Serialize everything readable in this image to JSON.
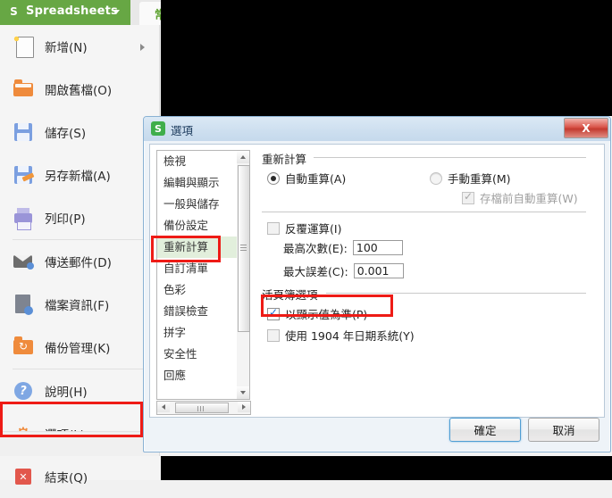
{
  "app": {
    "brand": {
      "logo": "S",
      "name": "Spreadsheets",
      "caret": "dropdown-caret"
    },
    "ribbon_tab": "常用",
    "menu_items": [
      {
        "label": "新增(N)",
        "icon": "new-document-icon",
        "has_submenu": true
      },
      {
        "label": "開啟舊檔(O)",
        "icon": "open-folder-icon",
        "has_submenu": false
      },
      {
        "label": "儲存(S)",
        "icon": "save-disk-icon",
        "has_submenu": false
      },
      {
        "label": "另存新檔(A)",
        "icon": "save-as-icon",
        "has_submenu": false
      },
      {
        "label": "列印(P)",
        "icon": "printer-icon",
        "has_submenu": false
      },
      {
        "label": "傳送郵件(D)",
        "icon": "mail-icon",
        "has_submenu": false
      },
      {
        "label": "檔案資訊(F)",
        "icon": "file-info-icon",
        "has_submenu": false
      },
      {
        "label": "備份管理(K)",
        "icon": "backup-folder-icon",
        "has_submenu": false
      },
      {
        "label": "說明(H)",
        "icon": "help-icon",
        "has_submenu": false
      },
      {
        "label": "選項(L)",
        "icon": "gear-icon",
        "has_submenu": false
      },
      {
        "label": "結束(Q)",
        "icon": "exit-icon",
        "has_submenu": false
      }
    ]
  },
  "dialog": {
    "title": "選項",
    "title_icon": "S",
    "close_label": "X",
    "categories": [
      "檢視",
      "編輯與顯示",
      "一般與儲存",
      "備份設定",
      "重新計算",
      "自訂清單",
      "色彩",
      "錯誤檢查",
      "拼字",
      "安全性",
      "回應"
    ],
    "selected_category": "重新計算",
    "groups": {
      "recalc": {
        "title": "重新計算",
        "auto_label": "自動重算(A)",
        "auto_checked": true,
        "manual_label": "手動重算(M)",
        "manual_checked": false,
        "recalc_before_save_label": "存檔前自動重算(W)",
        "recalc_before_save_checked": true,
        "recalc_before_save_disabled": true,
        "iterative_label": "反覆運算(I)",
        "iterative_checked": false,
        "max_iterations_label": "最高次數(E):",
        "max_iterations_value": "100",
        "max_change_label": "最大誤差(C):",
        "max_change_value": "0.001"
      },
      "workbook": {
        "title": "活頁簿選項",
        "precision_label": "以顯示值為準(P)",
        "precision_checked": true,
        "date1904_label": "使用 1904 年日期系統(Y)",
        "date1904_checked": false
      }
    },
    "buttons": {
      "ok": "確定",
      "cancel": "取消"
    }
  },
  "annotations": {
    "highlight_color": "#ee1b16",
    "boxes": [
      "選項(L) 選單項目",
      "重新計算 分類",
      "以顯示值為準(P) 核取方塊"
    ]
  }
}
